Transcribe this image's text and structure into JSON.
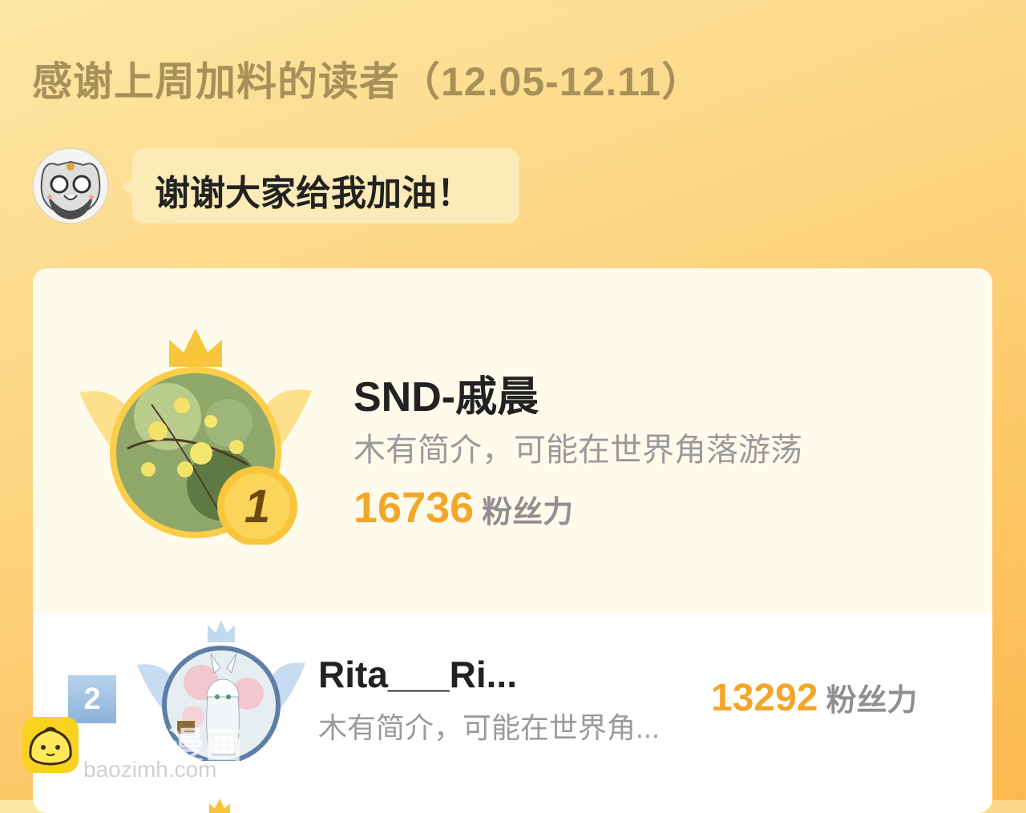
{
  "header": {
    "title": "感谢上周加料的读者（12.05-12.11）"
  },
  "speech": {
    "text": "谢谢大家给我加油！"
  },
  "ranking": {
    "first": {
      "rank": "1",
      "name": "SND-戚晨",
      "bio": "木有简介，可能在世界角落游荡",
      "score": "16736",
      "unit": "粉丝力"
    },
    "second": {
      "rank": "2",
      "name": "Rita___Ri...",
      "bio": "木有简介，可能在世界角...",
      "score": "13292",
      "unit": "粉丝力"
    }
  },
  "watermark": {
    "text": "包子漫画",
    "url": "baozimh.com"
  },
  "colors": {
    "title": "#a8905a",
    "score": "#f2a72a",
    "gold": "#f9c53a",
    "silver": "#8cb2d9"
  }
}
